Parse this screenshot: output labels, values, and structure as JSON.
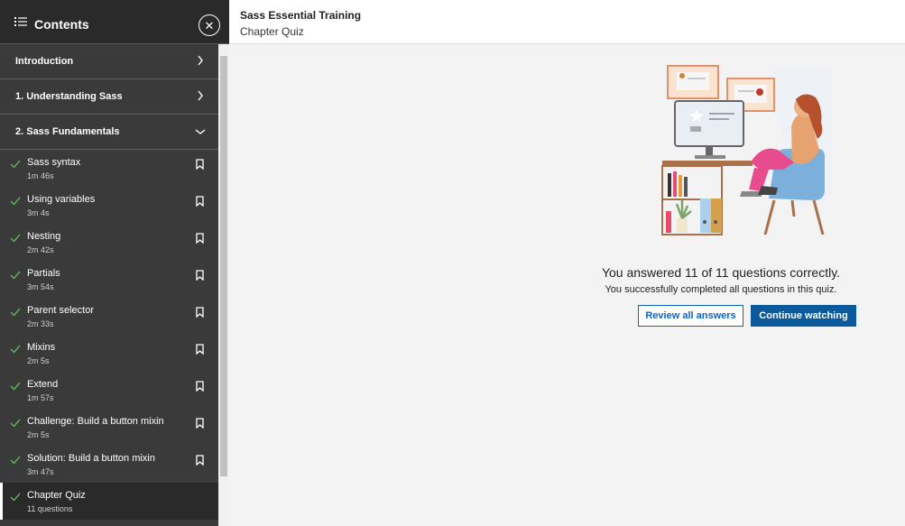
{
  "sidebar": {
    "title": "Contents",
    "chapters": [
      {
        "label": "Introduction",
        "state": "collapsed"
      },
      {
        "label": "1. Understanding Sass",
        "state": "collapsed"
      },
      {
        "label": "2. Sass Fundamentals",
        "state": "expanded"
      }
    ],
    "lessons": [
      {
        "title": "Sass syntax",
        "meta": "1m 46s"
      },
      {
        "title": "Using variables",
        "meta": "3m 4s"
      },
      {
        "title": "Nesting",
        "meta": "2m 42s"
      },
      {
        "title": "Partials",
        "meta": "3m 54s"
      },
      {
        "title": "Parent selector",
        "meta": "2m 33s"
      },
      {
        "title": "Mixins",
        "meta": "2m 5s"
      },
      {
        "title": "Extend",
        "meta": "1m 57s"
      },
      {
        "title": "Challenge: Build a button mixin",
        "meta": "2m 5s"
      },
      {
        "title": "Solution: Build a button mixin",
        "meta": "3m 47s"
      },
      {
        "title": "Chapter Quiz",
        "meta": "11 questions",
        "active": true
      }
    ]
  },
  "header": {
    "course_title": "Sass Essential Training",
    "subtitle": "Chapter Quiz"
  },
  "result": {
    "title": "You answered 11 of 11 questions correctly.",
    "message": "You successfully completed all questions in this quiz.",
    "review_label": "Review all answers",
    "continue_label": "Continue watching"
  },
  "colors": {
    "accent": "#0a66c2",
    "check": "#5fb55a",
    "sidebar_bg": "#3a3a3a"
  },
  "icons": {
    "list": "list-icon",
    "close": "close-icon",
    "chevron_right": "chevron-right-icon",
    "chevron_down": "chevron-down-icon",
    "check": "check-icon",
    "bookmark": "bookmark-icon"
  }
}
